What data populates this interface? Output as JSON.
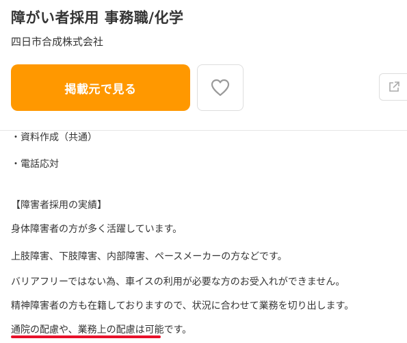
{
  "job": {
    "title": "障がい者採用 事務職/化学",
    "company": "四日市合成株式会社"
  },
  "actions": {
    "view_label": "掲載元で見る",
    "favorite_icon": "heart-icon",
    "share_icon": "external-link-icon"
  },
  "description": {
    "duties": [
      "・資料作成（共通）",
      "・電話応対"
    ],
    "section_heading": "【障害者採用の実績】",
    "paragraphs": [
      "身体障害者の方が多く活躍しています。",
      "上肢障害、下肢障害、内部障害、ペースメーカーの方などです。",
      "バリアフリーではない為、車イスの利用が必要な方のお受入れができません。",
      "精神障害者の方も在籍しておりますので、状況に合わせて業務を切り出します。",
      "通院の配慮や、業務上の配慮は可能です。"
    ]
  },
  "colors": {
    "accent": "#ff9800",
    "underline": "#e8102a"
  }
}
